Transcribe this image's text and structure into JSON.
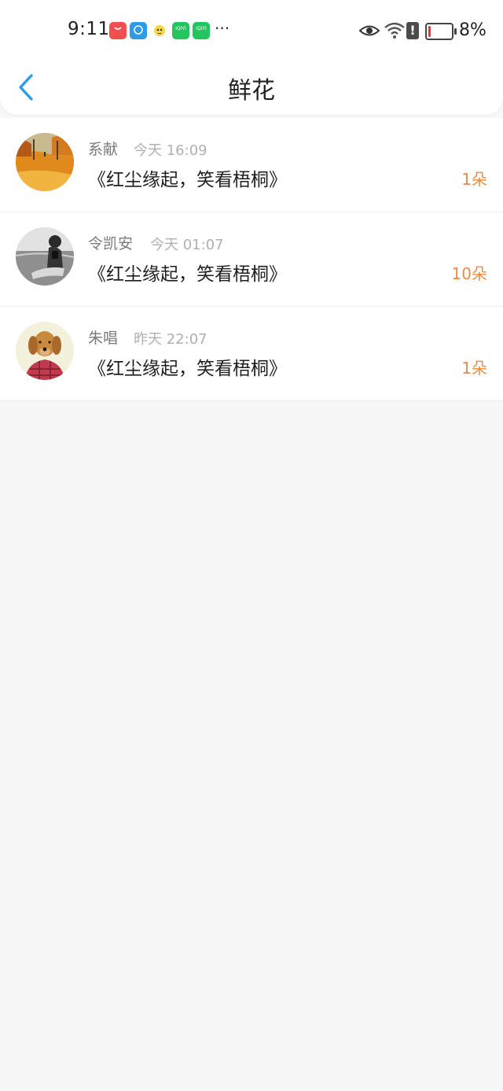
{
  "status_bar": {
    "time": "9:11",
    "app_icons": [
      "huawei-appgallery-icon",
      "chat-app-icon",
      "bird-app-icon",
      "iqiyi-icon",
      "iqiyi-icon"
    ],
    "more": "···",
    "battery": "8%"
  },
  "nav": {
    "title": "鲜花",
    "back_icon": "chevron-left-icon"
  },
  "colors": {
    "accent": "#2f9be6",
    "count": "#ea8c48",
    "name": "#7a7a7a",
    "time": "#b0b0b0",
    "text": "#1f1f1f",
    "background": "#f8f7f8"
  },
  "list": {
    "items": [
      {
        "name": "系献",
        "time": "今天 16:09",
        "message": "《红尘缘起，笑看梧桐》",
        "count": "1朵",
        "avatar": "autumn-leaves-avatar"
      },
      {
        "name": "令凯安",
        "time": "今天 01:07",
        "message": "《红尘缘起，笑看梧桐》",
        "count": "10朵",
        "avatar": "woman-photo-avatar"
      },
      {
        "name": "朱唱",
        "time": "昨天 22:07",
        "message": "《红尘缘起，笑看梧桐》",
        "count": "1朵",
        "avatar": "dog-in-shirt-avatar"
      }
    ]
  }
}
